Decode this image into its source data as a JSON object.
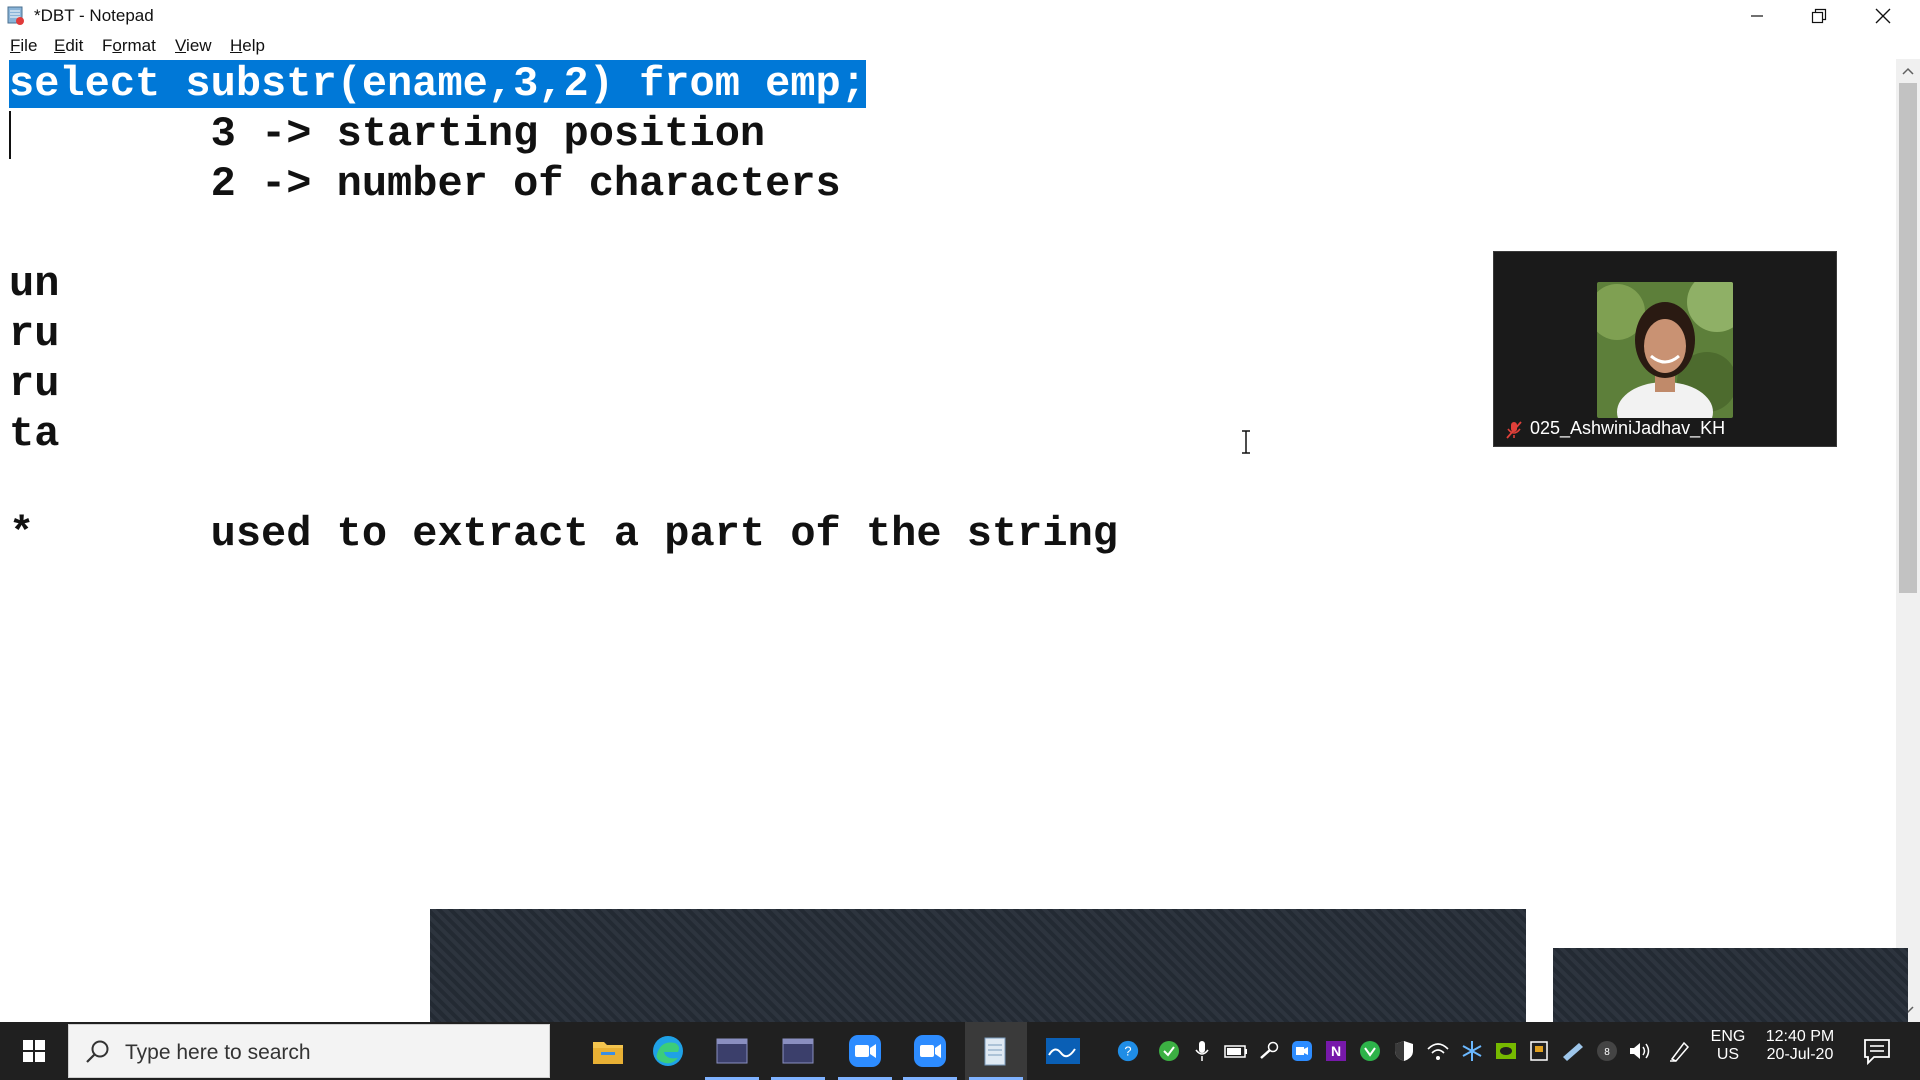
{
  "window": {
    "title": "*DBT - Notepad"
  },
  "menu": {
    "file": {
      "first": "F",
      "rest": "ile"
    },
    "edit": {
      "first": "E",
      "rest": "dit"
    },
    "format": {
      "first": "F",
      "mid": "o",
      "rest": "rmat",
      "pre": ""
    },
    "view": {
      "first": "V",
      "rest": "iew"
    },
    "help": {
      "first": "H",
      "rest": "elp"
    }
  },
  "editor": {
    "lines": [
      "select substr(ename,3,2) from emp;",
      "        3 -> starting position",
      "        2 -> number of characters",
      "",
      "un",
      "ru",
      "ru",
      "ta",
      "",
      "*       used to extract a part of the string"
    ]
  },
  "video": {
    "participant_name": "025_AshwiniJadhav_KH"
  },
  "taskbar": {
    "search_placeholder": "Type here to search",
    "language": "ENG",
    "region": "US",
    "time": "12:40 PM",
    "date": "20-Jul-20"
  },
  "colors": {
    "selection": "#0078d7",
    "taskbar": "#202020"
  }
}
